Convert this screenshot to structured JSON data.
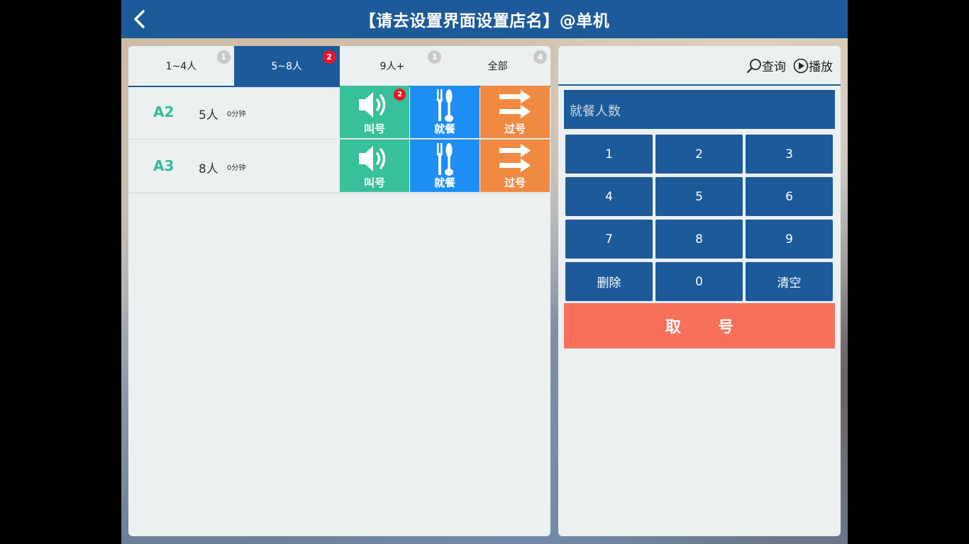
{
  "header": {
    "title": "【请去设置界面设置店名】@单机"
  },
  "tabs": [
    {
      "label": "1~4人",
      "count": "1",
      "active": false
    },
    {
      "label": "5~8人",
      "count": "2",
      "active": true
    },
    {
      "label": "9人+",
      "count": "1",
      "active": false
    },
    {
      "label": "全部",
      "count": "4",
      "active": false
    }
  ],
  "queue": [
    {
      "code": "A2",
      "people": "5人",
      "wait": "0分钟",
      "call_count": "2"
    },
    {
      "code": "A3",
      "people": "8人",
      "wait": "0分钟",
      "call_count": ""
    }
  ],
  "actions": {
    "call_label": "叫号",
    "dine_label": "就餐",
    "skip_label": "过号"
  },
  "tools": {
    "query_label": "查询",
    "play_label": "播放"
  },
  "input": {
    "placeholder": "就餐人数"
  },
  "keypad": {
    "keys": [
      "1",
      "2",
      "3",
      "4",
      "5",
      "6",
      "7",
      "8",
      "9",
      "删除",
      "0",
      "清空"
    ]
  },
  "take_number_label": "取号",
  "colors": {
    "primary": "#1c5a9a",
    "call": "#37c09a",
    "dine": "#1e8ef2",
    "skip": "#f08a42",
    "take": "#f6705c",
    "badge_red": "#e8152b",
    "badge_gray": "#c9c9c9",
    "code_green": "#33bb9b"
  }
}
